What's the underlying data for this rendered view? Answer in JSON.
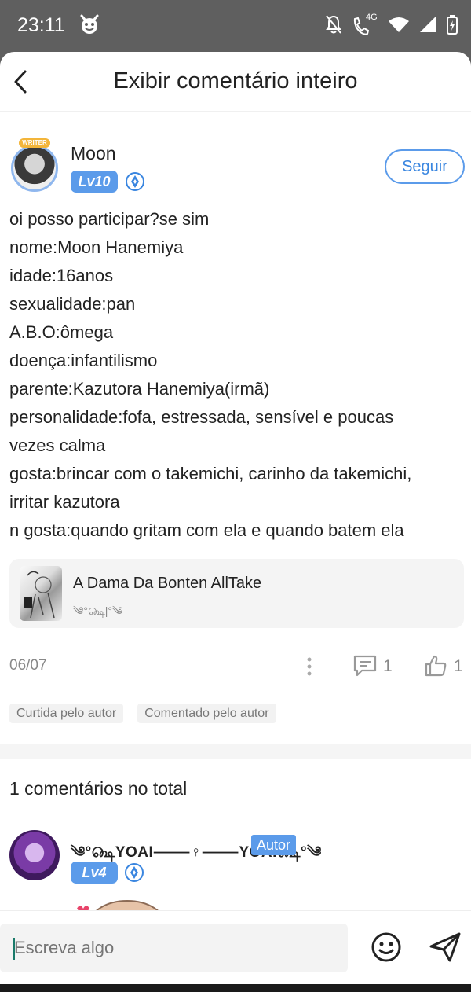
{
  "status_bar": {
    "time": "23:11",
    "network_label": "4G",
    "icons": [
      "devil-emoji-icon",
      "mute-icon",
      "call-4g-icon",
      "wifi-icon",
      "signal-icon",
      "battery-icon"
    ]
  },
  "navbar": {
    "title": "Exibir comentário inteiro",
    "back_icon": "chevron-left-icon"
  },
  "comment": {
    "author": "Moon",
    "avatar_frame_label": "WRITER",
    "level": "Lv10",
    "follow_label": "Seguir",
    "lines": [
      "oi posso participar?se sim",
      "nome:Moon Hanemiya",
      "idade:16anos",
      "sexualidade:pan",
      "A.B.O:ômega",
      "doença:infantilismo",
      "parente:Kazutora Hanemiya(irmã)",
      "personalidade:fofa, estressada, sensível e poucas",
      "vezes calma",
      "gosta:brincar com o takemichi, carinho da takemichi,",
      "irritar kazutora",
      "n gosta:quando gritam com ela e quando batem ela"
    ],
    "post": {
      "title": "A Dama Da Bonten AllTake",
      "subtitle": "༄°௸|°༄"
    },
    "date": "06/07",
    "comment_count": "1",
    "like_count": "1",
    "tags": [
      "Curtida pelo autor",
      "Comentado pelo autor"
    ]
  },
  "comments_section": {
    "total_label": "1 comentários no total",
    "replies": [
      {
        "author": "༄°௸YOAI⸻♀⸻YOAI௸°༄",
        "author_badge": "Autor",
        "level": "Lv4"
      }
    ]
  },
  "input_bar": {
    "placeholder": "Escreva algo"
  },
  "colors": {
    "accent": "#5b9bea",
    "status_bar": "#5f5f5f",
    "muted_text": "#888888",
    "frame_badge": "#f3b53a"
  }
}
